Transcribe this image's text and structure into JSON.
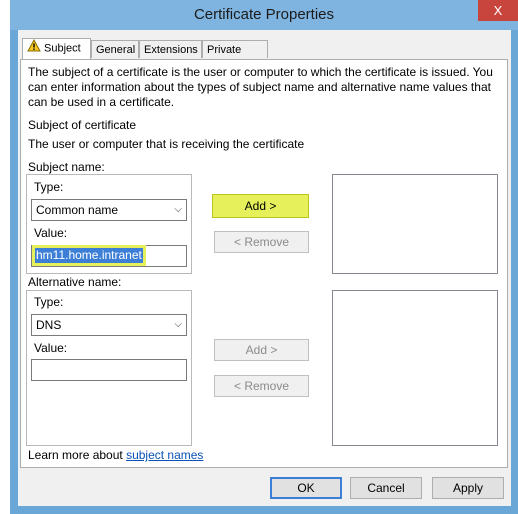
{
  "window": {
    "title": "Certificate Properties",
    "close": "X"
  },
  "tabs": [
    {
      "label": "Subject"
    },
    {
      "label": "General"
    },
    {
      "label": "Extensions"
    },
    {
      "label": "Private Key"
    }
  ],
  "intro": {
    "line1": "The subject of a certificate is the user or computer to which the certificate is issued. You",
    "line2": "can enter information about the types of subject name and alternative name values that",
    "line3": "can be used in a certificate."
  },
  "subject_of_certificate": {
    "heading": "Subject of certificate",
    "desc": "The user or computer that is receiving the certificate"
  },
  "subject_name": {
    "label": "Subject name:",
    "type_label": "Type:",
    "type_value": "Common name",
    "value_label": "Value:",
    "value_text": "hm11.home.intranet",
    "add_label": "Add >",
    "remove_label": "< Remove"
  },
  "alt_name": {
    "label": "Alternative name:",
    "type_label": "Type:",
    "type_value": "DNS",
    "value_label": "Value:",
    "value_text": "",
    "add_label": "Add >",
    "remove_label": "< Remove"
  },
  "learn_more": {
    "prefix": "Learn more about ",
    "link": "subject names"
  },
  "footer": {
    "ok": "OK",
    "cancel": "Cancel",
    "apply": "Apply"
  },
  "colors": {
    "highlight": "#e5f05a",
    "titlebar": "#7fb4e0",
    "close": "#c7453d"
  },
  "icons": {
    "subject_tab_icon": "warning-icon"
  }
}
